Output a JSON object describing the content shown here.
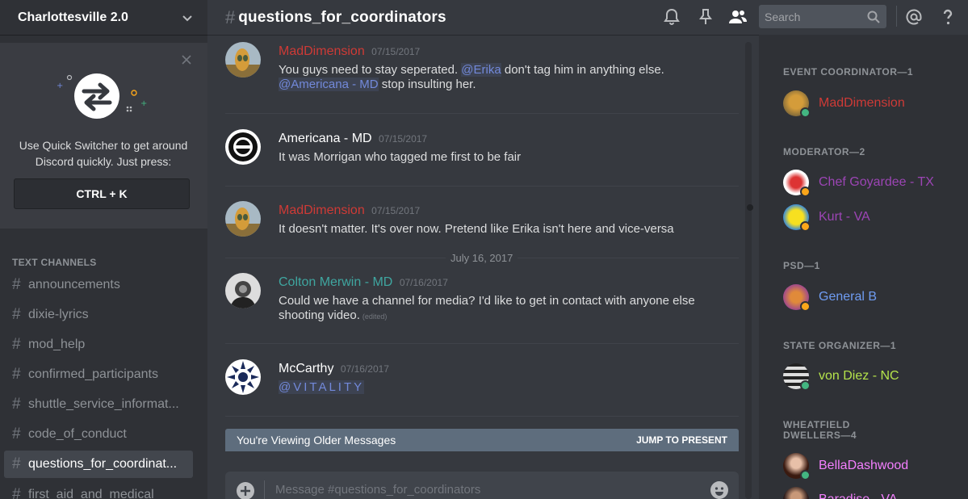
{
  "guild": {
    "name": "Charlottesville 2.0"
  },
  "quick_switcher": {
    "text_line1": "Use Quick Switcher to get around",
    "text_line2": "Discord quickly. Just press:",
    "shortcut": "CTRL + K"
  },
  "channels": {
    "header": "TEXT CHANNELS",
    "items": [
      "announcements",
      "dixie-lyrics",
      "mod_help",
      "confirmed_participants",
      "shuttle_service_informat...",
      "code_of_conduct",
      "questions_for_coordinat...",
      "first_aid_and_medical"
    ],
    "active_index": 6
  },
  "topbar": {
    "channel": "questions_for_coordinators",
    "search_placeholder": "Search"
  },
  "messages": [
    {
      "author": "MadDimension",
      "color": "#ce3a36",
      "timestamp": "07/15/2017",
      "lines": [
        "You guys need to stay seperated.",
        "@Erika",
        "don't tag him in anything else.",
        "@Americana - MD",
        "stop insulting her."
      ]
    },
    {
      "author": "Americana - MD",
      "color": "#ffffff",
      "timestamp": "07/15/2017",
      "text": "It was Morrigan who tagged me first to be fair"
    },
    {
      "author": "MadDimension",
      "color": "#ce3a36",
      "timestamp": "07/15/2017",
      "text": "It doesn't matter. It's over now. Pretend like Erika isn't here and vice-versa"
    },
    {
      "author": "Colton Merwin - MD",
      "color": "#3fa6a0",
      "timestamp": "07/16/2017",
      "text_line1": "Could we have a channel for media? I'd like to get in contact with anyone else",
      "text_line2": "shooting video.",
      "edited": "(edited)"
    },
    {
      "author": "McCarthy",
      "color": "#ffffff",
      "timestamp": "07/16/2017",
      "mention": "@VITALITY"
    }
  ],
  "date_divider": "July 16, 2017",
  "older_bar": {
    "text": "You're Viewing Older Messages",
    "jump": "JUMP TO PRESENT"
  },
  "composer": {
    "placeholder": "Message #questions_for_coordinators"
  },
  "members": {
    "roles": [
      {
        "title": "EVENT COORDINATOR—1"
      },
      {
        "title": "MODERATOR—2"
      },
      {
        "title": "PSD—1"
      },
      {
        "title": "STATE ORGANIZER—1"
      },
      {
        "title_line1": "WHEATFIELD",
        "title_line2": "DWELLERS—4"
      }
    ],
    "list": [
      {
        "name": "MadDimension",
        "color": "#ce3a36",
        "status": "online"
      },
      {
        "name": "Chef Goyardee - TX",
        "color": "#9c45b5",
        "status": "idle"
      },
      {
        "name": "Kurt - VA",
        "color": "#9c45b5",
        "status": "idle"
      },
      {
        "name": "General B",
        "color": "#6f9cf2",
        "status": "idle"
      },
      {
        "name": "von Diez - NC",
        "color": "#b5e34b",
        "status": "online"
      },
      {
        "name": "BellaDashwood",
        "color": "#f47fff",
        "status": "online"
      },
      {
        "name": "Baradise - VA",
        "color": "#f47fff",
        "status": "online"
      }
    ]
  },
  "colors": {
    "online": "#43b581",
    "idle": "#faa61a",
    "mention": "#7289da",
    "background": "#36393f",
    "sidebar": "#2f3136"
  }
}
